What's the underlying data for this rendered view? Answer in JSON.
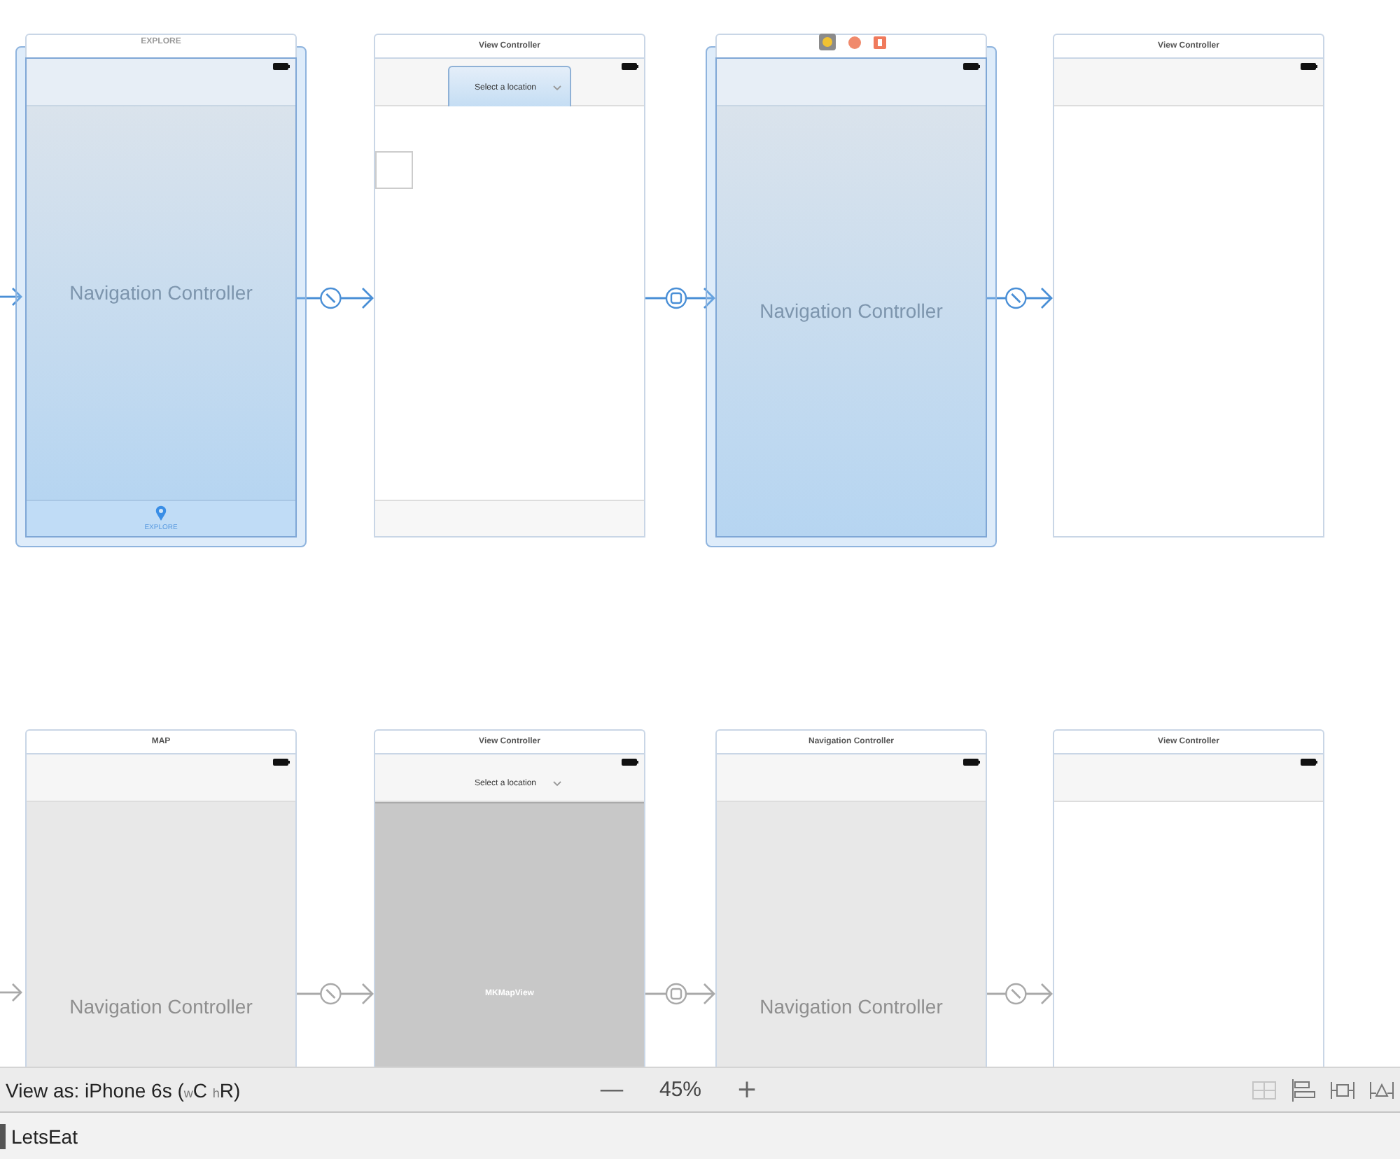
{
  "canvas": {
    "rows": [
      {
        "incoming": {
          "selected": true
        },
        "scenes": [
          {
            "kind": "navigation",
            "title": "EXPLORE",
            "selected": true,
            "label": "Navigation Controller",
            "tab_label": "EXPLORE"
          },
          {
            "kind": "view",
            "title": "View Controller",
            "selected": false,
            "title_button": {
              "label": "Select a location",
              "selected": true
            },
            "subview": true,
            "toolbar": true
          },
          {
            "kind": "navigation",
            "selected": true,
            "dock": true,
            "label": "Navigation Controller"
          },
          {
            "kind": "view",
            "title": "View Controller",
            "selected": false
          }
        ],
        "segues": [
          {
            "kind": "relationship",
            "selected": true
          },
          {
            "kind": "modal",
            "selected": true
          },
          {
            "kind": "relationship",
            "selected": true
          }
        ]
      },
      {
        "incoming": {
          "selected": false
        },
        "scenes": [
          {
            "kind": "navigation",
            "title": "MAP",
            "selected": false,
            "label": "Navigation Controller"
          },
          {
            "kind": "view",
            "title": "View Controller",
            "selected": false,
            "title_button": {
              "label": "Select a location",
              "selected": false
            },
            "map_label": "MKMapView"
          },
          {
            "kind": "navigation",
            "title": "Navigation Controller",
            "selected": false,
            "label": "Navigation Controller"
          },
          {
            "kind": "view",
            "title": "View Controller",
            "selected": false
          }
        ],
        "segues": [
          {
            "kind": "relationship",
            "selected": false
          },
          {
            "kind": "modal",
            "selected": false
          },
          {
            "kind": "relationship",
            "selected": false
          }
        ]
      }
    ]
  },
  "bottom_bar": {
    "view_as": "View as: iPhone 6s ($_{w}$C $_{h}$R)",
    "zoom_out": "—",
    "zoom": "45%",
    "zoom_in": "+"
  },
  "file_bar": {
    "name": "LetsEat"
  }
}
